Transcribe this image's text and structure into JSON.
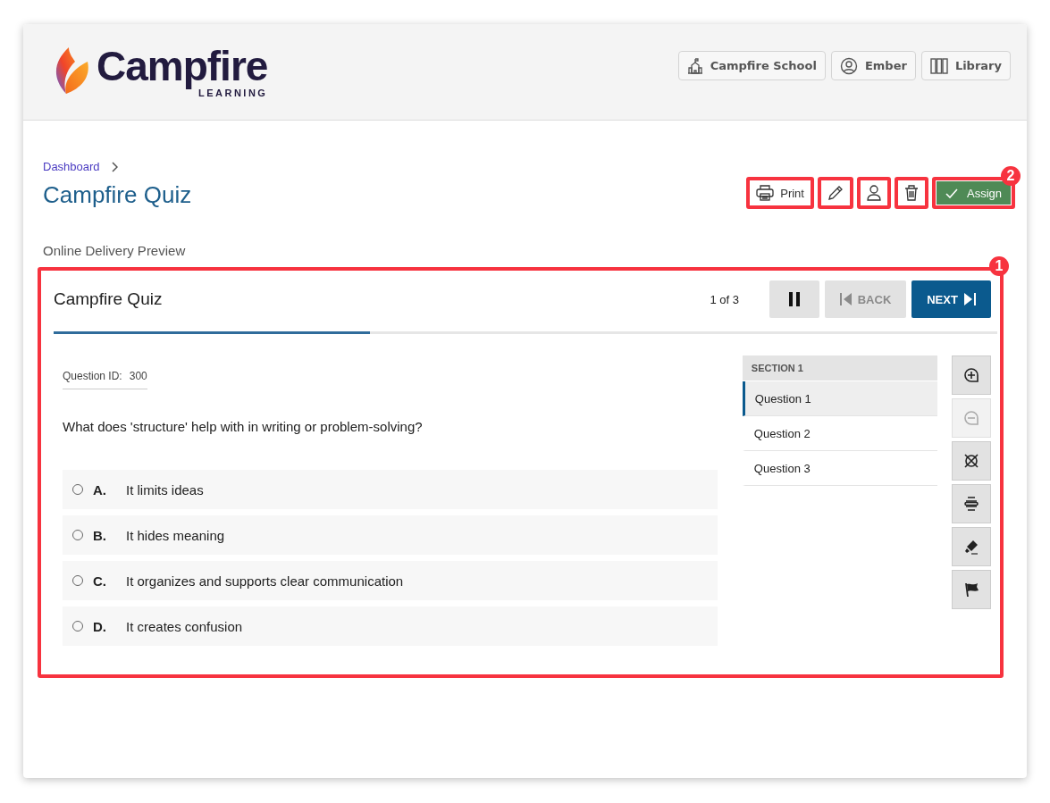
{
  "header": {
    "logo": {
      "name": "Campfire",
      "tagline": "LEARNING"
    },
    "buttons": [
      {
        "kind": "school",
        "label": "Campfire School"
      },
      {
        "kind": "user",
        "label": "Ember"
      },
      {
        "kind": "library",
        "label": "Library"
      }
    ]
  },
  "breadcrumb": [
    {
      "label": "Dashboard"
    }
  ],
  "title": "Campfire Quiz",
  "actions": [
    {
      "kind": "print",
      "label": "Print",
      "highlighted": true
    },
    {
      "kind": "edit",
      "highlighted": true
    },
    {
      "kind": "user",
      "highlighted": true
    },
    {
      "kind": "delete",
      "highlighted": true
    },
    {
      "kind": "assign",
      "label": "Assign",
      "highlighted": true,
      "callout": "2"
    }
  ],
  "preview_label": "Online Delivery Preview",
  "quiz": {
    "callout": "1",
    "title": "Campfire Quiz",
    "counter": "1 of 3",
    "progress": {
      "level": 0.335
    },
    "controls": [
      {
        "kind": "pause",
        "disabled": false
      },
      {
        "kind": "back",
        "label": "BACK",
        "disabled": true
      },
      {
        "kind": "next",
        "label": "NEXT",
        "disabled": false
      }
    ],
    "question_id": {
      "label": "Question ID:",
      "value": "300"
    },
    "question": "What does 'structure' help with in writing or problem-solving?",
    "options": [
      {
        "letter": "A.",
        "text": "It limits ideas",
        "selected": false
      },
      {
        "letter": "B.",
        "text": "It hides meaning",
        "selected": false
      },
      {
        "letter": "C.",
        "text": "It organizes and supports clear communication",
        "selected": false
      },
      {
        "letter": "D.",
        "text": "It creates confusion",
        "selected": false
      }
    ],
    "nav": {
      "section": "SECTION 1",
      "items": [
        {
          "label": "Question 1",
          "selected": true
        },
        {
          "label": "Question 2",
          "selected": false
        },
        {
          "label": "Question 3",
          "selected": false
        }
      ]
    },
    "tools": [
      {
        "kind": "zoom-in",
        "disabled": false
      },
      {
        "kind": "zoom-out",
        "disabled": true
      },
      {
        "kind": "eliminate",
        "disabled": false
      },
      {
        "kind": "line-reader",
        "disabled": false
      },
      {
        "kind": "highlighter",
        "disabled": false
      },
      {
        "kind": "flag",
        "disabled": false
      }
    ]
  }
}
